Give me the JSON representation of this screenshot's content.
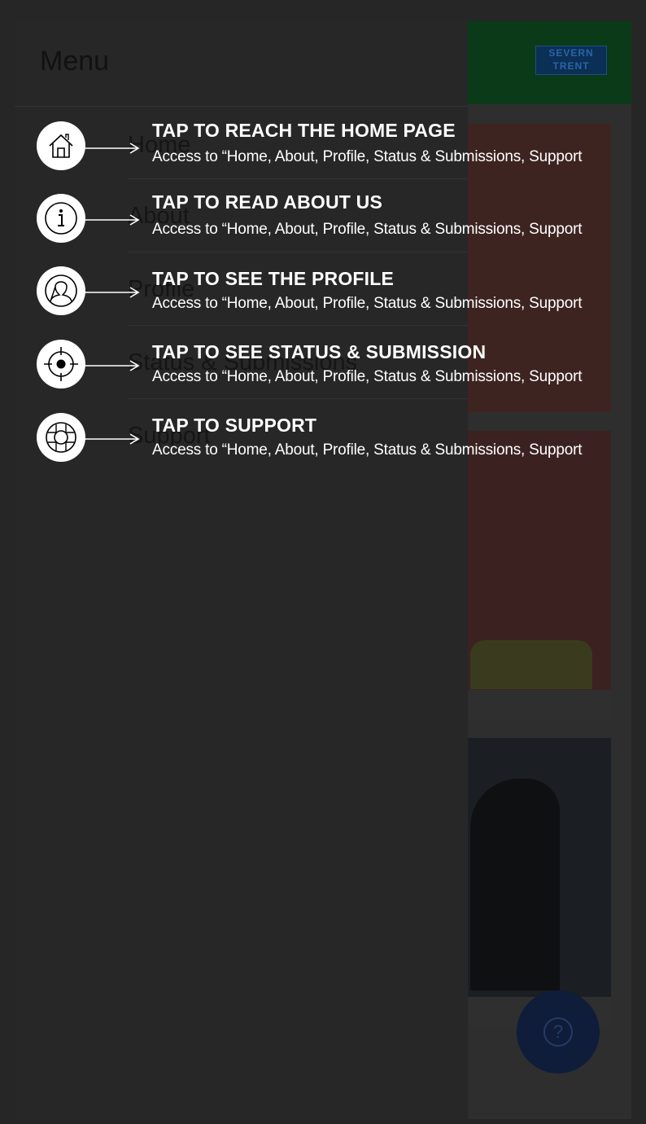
{
  "app": {
    "logo_line1": "SEVERN",
    "logo_line2": "TRENT",
    "help_icon": "?"
  },
  "drawer": {
    "title": "Menu",
    "items": [
      {
        "label": "Home"
      },
      {
        "label": "About"
      },
      {
        "label": "Profile"
      },
      {
        "label": "Status & Submissions"
      },
      {
        "label": "Support"
      }
    ]
  },
  "overlay": {
    "hints": [
      {
        "icon": "home-icon",
        "title": "TAP TO REACH THE HOME PAGE",
        "desc": "Access to “Home, About, Profile, Status & Submissions, Support"
      },
      {
        "icon": "info-icon",
        "title": "TAP TO READ ABOUT US",
        "desc": "Access to “Home, About, Profile, Status & Submissions, Support"
      },
      {
        "icon": "profile-icon",
        "title": "TAP TO SEE THE PROFILE",
        "desc": "Access to “Home, About, Profile, Status & Submissions, Support"
      },
      {
        "icon": "target-icon",
        "title": "TAP TO SEE STATUS & SUBMISSION",
        "desc": "Access to “Home, About, Profile, Status & Submissions, Support"
      },
      {
        "icon": "lifebuoy-icon",
        "title": "TAP TO SUPPORT",
        "desc": "Access to “Home, About, Profile, Status & Submissions, Support"
      }
    ]
  },
  "colors": {
    "overlay_bg": "#262626",
    "header_green": "#0a3a17",
    "fab_blue": "#0f1d3a",
    "hint_text": "#ffffff"
  }
}
